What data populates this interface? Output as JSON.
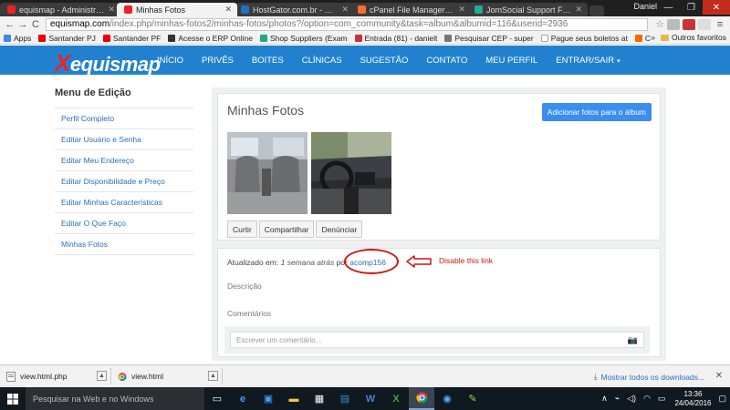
{
  "browser": {
    "tabs": [
      {
        "title": "equismap - Administraçã",
        "color": "#e22"
      },
      {
        "title": "Minhas Fotos",
        "color": "#e22",
        "active": true
      },
      {
        "title": "HostGator.com.br - Painel",
        "color": "#1a73c9"
      },
      {
        "title": "cPanel File Manager v3",
        "color": "#ff6c2c"
      },
      {
        "title": "JomSocial Support Forum",
        "color": "#2a9"
      }
    ],
    "user": "Daniel",
    "window_controls": {
      "minimize": "—",
      "maximize": "❐",
      "close": "✕"
    },
    "url_host": "equismap.com",
    "url_path": "/index.php/minhas-fotos2/minhas-fotos/photos?/option=com_community&task=album&albumid=116&userid=2936",
    "bookmarks": [
      {
        "label": "Apps",
        "color": "#4285f4"
      },
      {
        "label": "Santander PJ",
        "color": "#e00"
      },
      {
        "label": "Santander PF",
        "color": "#e00"
      },
      {
        "label": "Acesse o ERP Online",
        "color": "#333"
      },
      {
        "label": "Shop Suppliers (Exam",
        "color": "#2a7"
      },
      {
        "label": "Entrada (81) - danielt",
        "color": "#c33"
      },
      {
        "label": "Pesquisar CEP - super",
        "color": "#777"
      },
      {
        "label": "Pague seus boletos at",
        "color": "#fff"
      },
      {
        "label": "CIÊNCIA MENTAL: SA",
        "color": "#f60"
      }
    ],
    "bookmarks_more": "»",
    "other_bookmarks": "Outros favoritos"
  },
  "site": {
    "logo": "equismap",
    "logo_x": "X",
    "nav": [
      "INÍCIO",
      "PRIVÊS",
      "BOITES",
      "CLÍNICAS",
      "SUGESTÃO",
      "CONTATO",
      "MEU PERFIL",
      "ENTRAR/SAIR"
    ],
    "nav_caret": "▾"
  },
  "sidebar": {
    "title": "Menu de Edição",
    "items": [
      "Perfil Completo",
      "Editar Usuário e Senha",
      "Editar Meu Endereço",
      "Editar Disponibilidade e Preço",
      "Editar Minhas Características",
      "Editar O Que Faço",
      "Minhas Fotos"
    ]
  },
  "album": {
    "title": "Minhas Fotos",
    "add_button": "Adicionar fotos para o álbum",
    "actions": [
      "Curtir",
      "Compartilhar",
      "Denúnciar"
    ],
    "updated_label": "Atualizado em:",
    "updated_time": "1 semana atrás",
    "by_label": "por",
    "author": "acomp156",
    "annotation": "Disable this link",
    "description_label": "Descrição",
    "comments_label": "Comentários",
    "comment_placeholder": "Escrever um comentário..."
  },
  "downloads": {
    "items": [
      {
        "name": "view.html.php"
      },
      {
        "name": "view.html"
      }
    ],
    "show_all": "Mostrar todos os downloads...",
    "close": "✕"
  },
  "taskbar": {
    "search_placeholder": "Pesquisar na Web e no Windows",
    "time": "13:36",
    "date": "24/04/2016"
  }
}
